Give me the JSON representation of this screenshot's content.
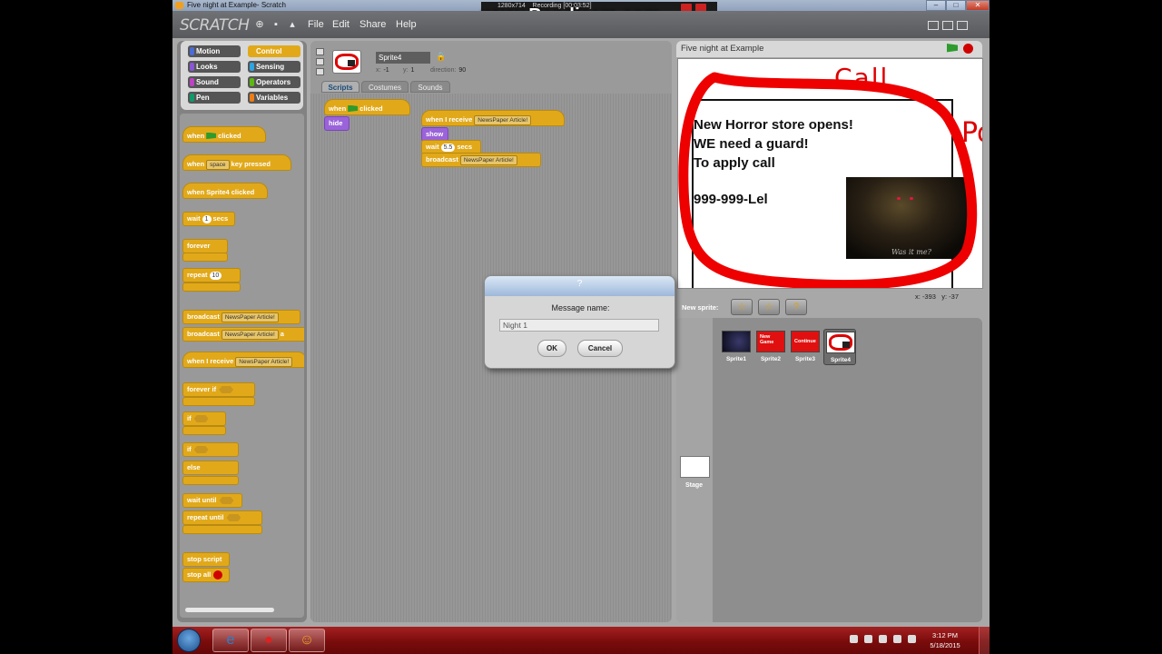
{
  "window": {
    "title": "Five night at Example- Scratch",
    "controls": [
      "–",
      "□",
      "✕"
    ]
  },
  "recorder": {
    "brand": "www.Bandicam.com",
    "resolution": "1280x714",
    "recording": "Recording [00:03:52]"
  },
  "menubar": {
    "logo": "SCRATCH",
    "items": [
      "File",
      "Edit",
      "Share",
      "Help"
    ]
  },
  "categories": [
    {
      "label": "Motion",
      "color": "#4a6cd4"
    },
    {
      "label": "Control",
      "color": "#e1a91a"
    },
    {
      "label": "Looks",
      "color": "#8a55d7"
    },
    {
      "label": "Sensing",
      "color": "#2ca5e2"
    },
    {
      "label": "Sound",
      "color": "#bb42c3"
    },
    {
      "label": "Operators",
      "color": "#5cb712"
    },
    {
      "label": "Pen",
      "color": "#0e9a6c"
    },
    {
      "label": "Variables",
      "color": "#ee7d16"
    }
  ],
  "palette": {
    "when_flag": [
      "when",
      "clicked"
    ],
    "when_key": [
      "when",
      "space",
      "key pressed"
    ],
    "when_sprite_clicked": "when Sprite4 clicked",
    "wait": [
      "wait",
      "1",
      "secs"
    ],
    "forever": "forever",
    "repeat": [
      "repeat",
      "10"
    ],
    "broadcast": [
      "broadcast",
      "NewsPaper Article!"
    ],
    "broadcast_wait": [
      "broadcast",
      "NewsPaper Article!",
      "a"
    ],
    "when_receive": [
      "when I receive",
      "NewsPaper Article!"
    ],
    "forever_if": "forever if",
    "if": "if",
    "if_else": [
      "if",
      "else"
    ],
    "wait_until": "wait until",
    "repeat_until": "repeat until",
    "stop_script": "stop script",
    "stop_all": "stop all"
  },
  "sprite": {
    "name": "Sprite4",
    "x_label": "x:",
    "x": "-1",
    "y_label": "y:",
    "y": "1",
    "direction_label": "direction:",
    "direction": "90"
  },
  "tabs": [
    "Scripts",
    "Costumes",
    "Sounds"
  ],
  "scripts": {
    "s1_when": "when",
    "s1_clicked": "clicked",
    "s1_hide": "hide",
    "s2_receive": "when I receive",
    "s2_msg": "NewsPaper Article!",
    "s2_show": "show",
    "s2_wait": "wait",
    "s2_wait_val": "5.5",
    "s2_secs": "secs",
    "s2_broadcast": "broadcast",
    "s2_broadcast_msg": "NewsPaper Article!"
  },
  "stage": {
    "title": "Five night at Example",
    "ad_lines": [
      "New Horror store opens!",
      "WE need a guard!",
      "To apply call",
      "999-999-Lel"
    ],
    "caption": "Was it me?",
    "call_text": "Call",
    "po_text": "Po",
    "mouse_x_label": "x:",
    "mouse_x": "-393",
    "mouse_y_label": "y:",
    "mouse_y": "-37"
  },
  "new_sprite": {
    "label": "New sprite:",
    "buttons": [
      "☆",
      "☆",
      "?"
    ]
  },
  "sprites": [
    {
      "label": "Sprite1",
      "thumb_text": ""
    },
    {
      "label": "Sprite2",
      "thumb_text": "New Game"
    },
    {
      "label": "Sprite3",
      "thumb_text": "Continue"
    },
    {
      "label": "Sprite4",
      "thumb_text": ""
    }
  ],
  "stage_item": {
    "label": "Stage"
  },
  "dialog": {
    "title": "?",
    "prompt": "Message name:",
    "value": "Night 1",
    "ok": "OK",
    "cancel": "Cancel"
  },
  "taskbar": {
    "time": "3:12 PM",
    "date": "5/18/2015"
  },
  "colors": {
    "control": "#e1a91a",
    "looks": "#9a63d9",
    "stage_ring": "#dd0000",
    "taskbar": "#8a1010"
  }
}
